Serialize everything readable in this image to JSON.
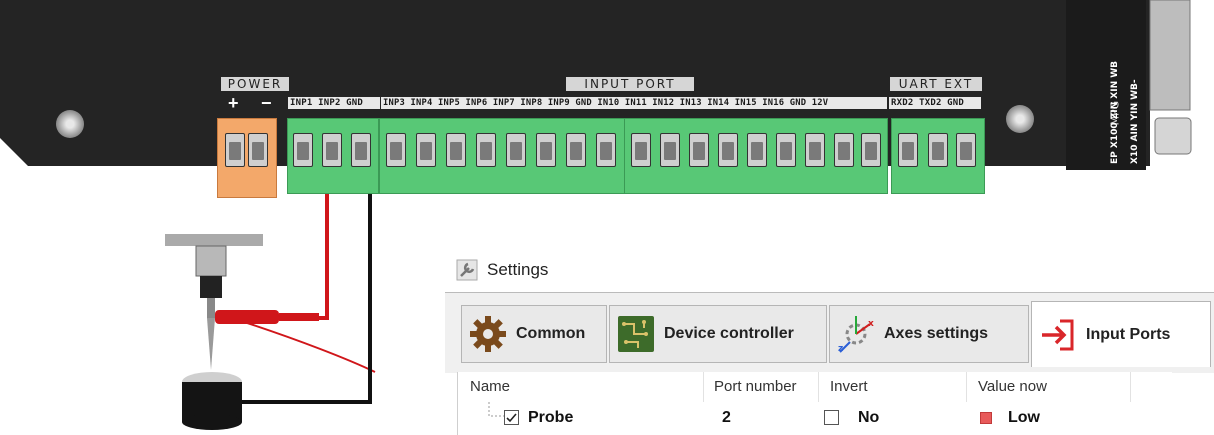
{
  "board": {
    "power_label": "POWER",
    "power_plus": "+",
    "power_minus": "−",
    "input_port_label": "INPUT PORT",
    "uart_label": "UART EXT",
    "pins_group1": "INP1 INP2 GND",
    "pins_group2": "INP3 INP4 INP5 INP6 INP7 INP8 INP9 GND IN10 IN11 IN12 IN13 IN14 IN15 IN16 GND 12V",
    "uart_pins": "RXD2 TXD2 GND",
    "side_text": [
      "MPG",
      "EP X100 ZIN XIN WB",
      "X10 AIN YIN WB-"
    ],
    "wire_colors": {
      "signal": "#d0161a",
      "ground": "#111111"
    }
  },
  "settings": {
    "title": "Settings",
    "tabs": [
      {
        "label": "Common",
        "icon": "gear-icon"
      },
      {
        "label": "Device controller",
        "icon": "circuit-board-icon"
      },
      {
        "label": "Axes settings",
        "icon": "axes-icon"
      },
      {
        "label": "Input Ports",
        "icon": "input-arrow-icon",
        "active": true
      }
    ],
    "columns": [
      "Name",
      "Port number",
      "Invert",
      "Value now"
    ],
    "rows": [
      {
        "name": "Probe",
        "checked": true,
        "port": "2",
        "invert": "No",
        "value": "Low",
        "value_color": "#e85a5a"
      }
    ]
  }
}
